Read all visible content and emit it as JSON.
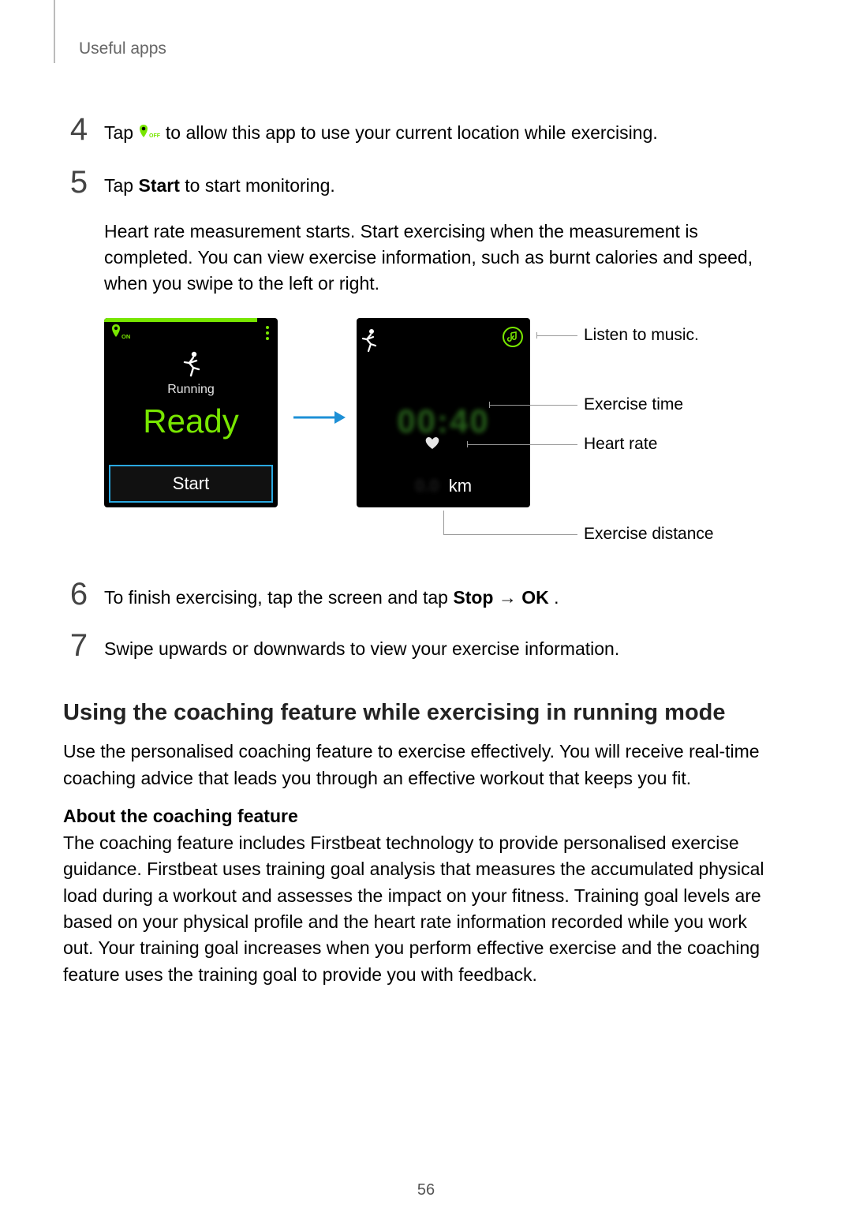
{
  "header": {
    "section": "Useful apps"
  },
  "steps": {
    "s4": {
      "num": "4",
      "pre": "Tap ",
      "post": " to allow this app to use your current location while exercising."
    },
    "s5": {
      "num": "5",
      "pre": "Tap ",
      "bold": "Start",
      "post": " to start monitoring.",
      "para": "Heart rate measurement starts. Start exercising when the measurement is completed. You can view exercise information, such as burnt calories and speed, when you swipe to the left or right."
    },
    "s6": {
      "num": "6",
      "pre": "To finish exercising, tap the screen and tap ",
      "bold1": "Stop",
      "arrow": " → ",
      "bold2": "OK",
      "post": "."
    },
    "s7": {
      "num": "7",
      "text": "Swipe upwards or downwards to view your exercise information."
    }
  },
  "figure": {
    "watch1": {
      "location_state": "ON",
      "mode": "Running",
      "ready": "Ready",
      "start": "Start"
    },
    "watch2": {
      "distance_unit": "km"
    },
    "callouts": {
      "music": "Listen to music.",
      "time": "Exercise time",
      "heart": "Heart rate",
      "distance": "Exercise distance"
    }
  },
  "coaching": {
    "heading": "Using the coaching feature while exercising in running mode",
    "intro": "Use the personalised coaching feature to exercise effectively. You will receive real-time coaching advice that leads you through an effective workout that keeps you fit.",
    "sub": "About the coaching feature",
    "body": "The coaching feature includes Firstbeat technology to provide personalised exercise guidance. Firstbeat uses training goal analysis that measures the accumulated physical load during a workout and assesses the impact on your fitness. Training goal levels are based on your physical profile and the heart rate information recorded while you work out. Your training goal increases when you perform effective exercise and the coaching feature uses the training goal to provide you with feedback."
  },
  "page_number": "56"
}
